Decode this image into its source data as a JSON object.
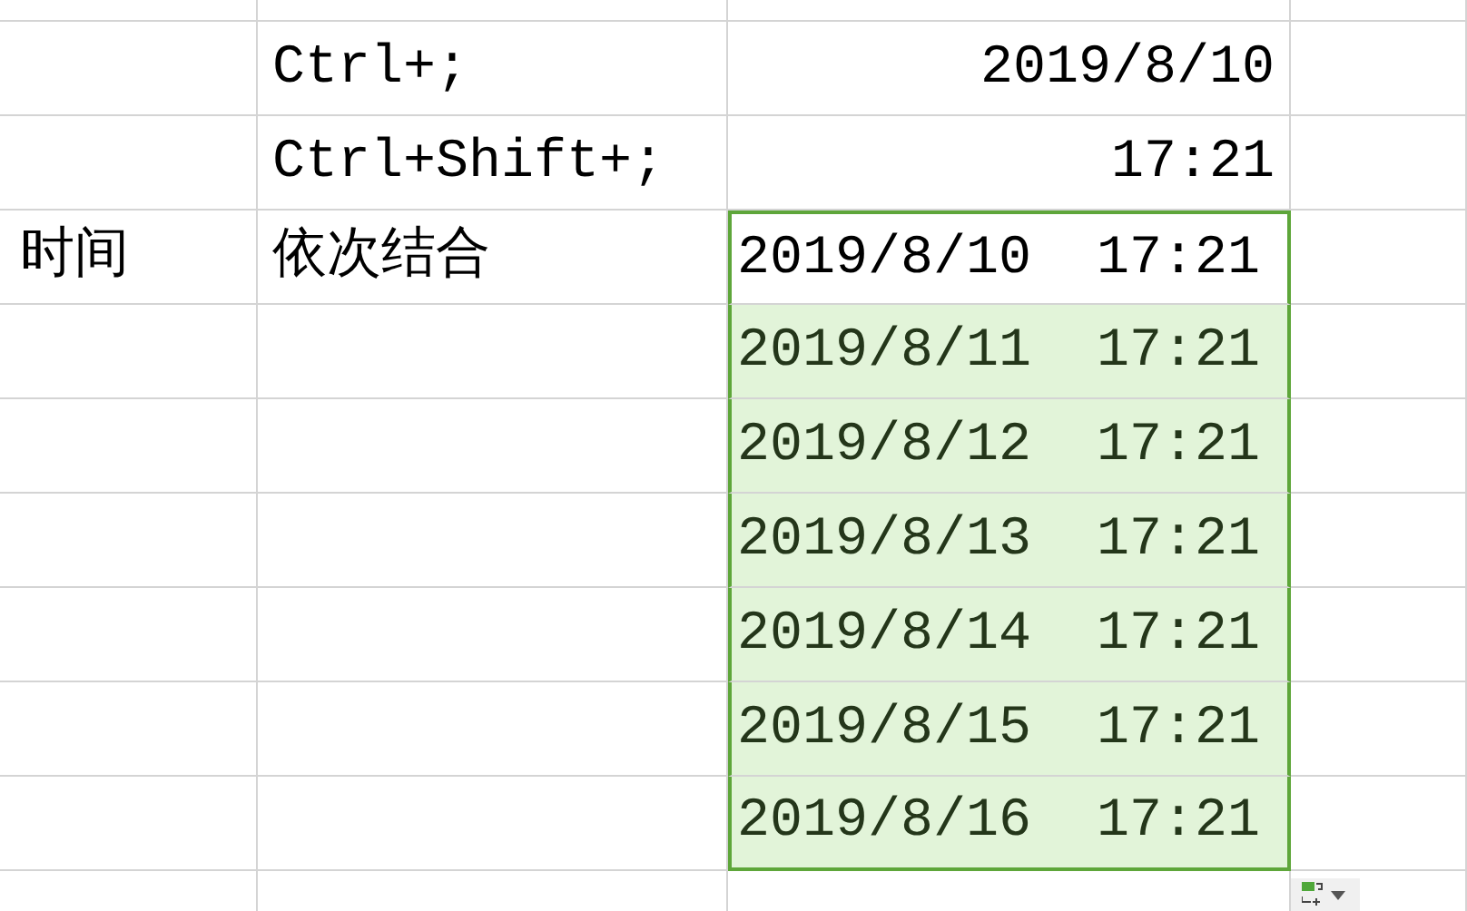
{
  "rows": [
    {
      "cells": [
        "",
        "",
        ""
      ],
      "selected": false,
      "active": false
    },
    {
      "cells": [
        "",
        "Ctrl+;",
        "2019/8/10"
      ],
      "selected": false,
      "active": false
    },
    {
      "cells": [
        "",
        "Ctrl+Shift+;",
        "17:21"
      ],
      "selected": false,
      "active": false
    },
    {
      "cells": [
        "时间",
        "依次结合",
        "2019/8/10  17:21"
      ],
      "selected": true,
      "active": true
    },
    {
      "cells": [
        "",
        "",
        "2019/8/11  17:21"
      ],
      "selected": true,
      "active": false
    },
    {
      "cells": [
        "",
        "",
        "2019/8/12  17:21"
      ],
      "selected": true,
      "active": false
    },
    {
      "cells": [
        "",
        "",
        "2019/8/13  17:21"
      ],
      "selected": true,
      "active": false
    },
    {
      "cells": [
        "",
        "",
        "2019/8/14  17:21"
      ],
      "selected": true,
      "active": false
    },
    {
      "cells": [
        "",
        "",
        "2019/8/15  17:21"
      ],
      "selected": true,
      "active": false
    },
    {
      "cells": [
        "",
        "",
        "2019/8/16  17:21"
      ],
      "selected": true,
      "active": false
    },
    {
      "cells": [
        "",
        "",
        ""
      ],
      "selected": false,
      "active": false
    }
  ]
}
